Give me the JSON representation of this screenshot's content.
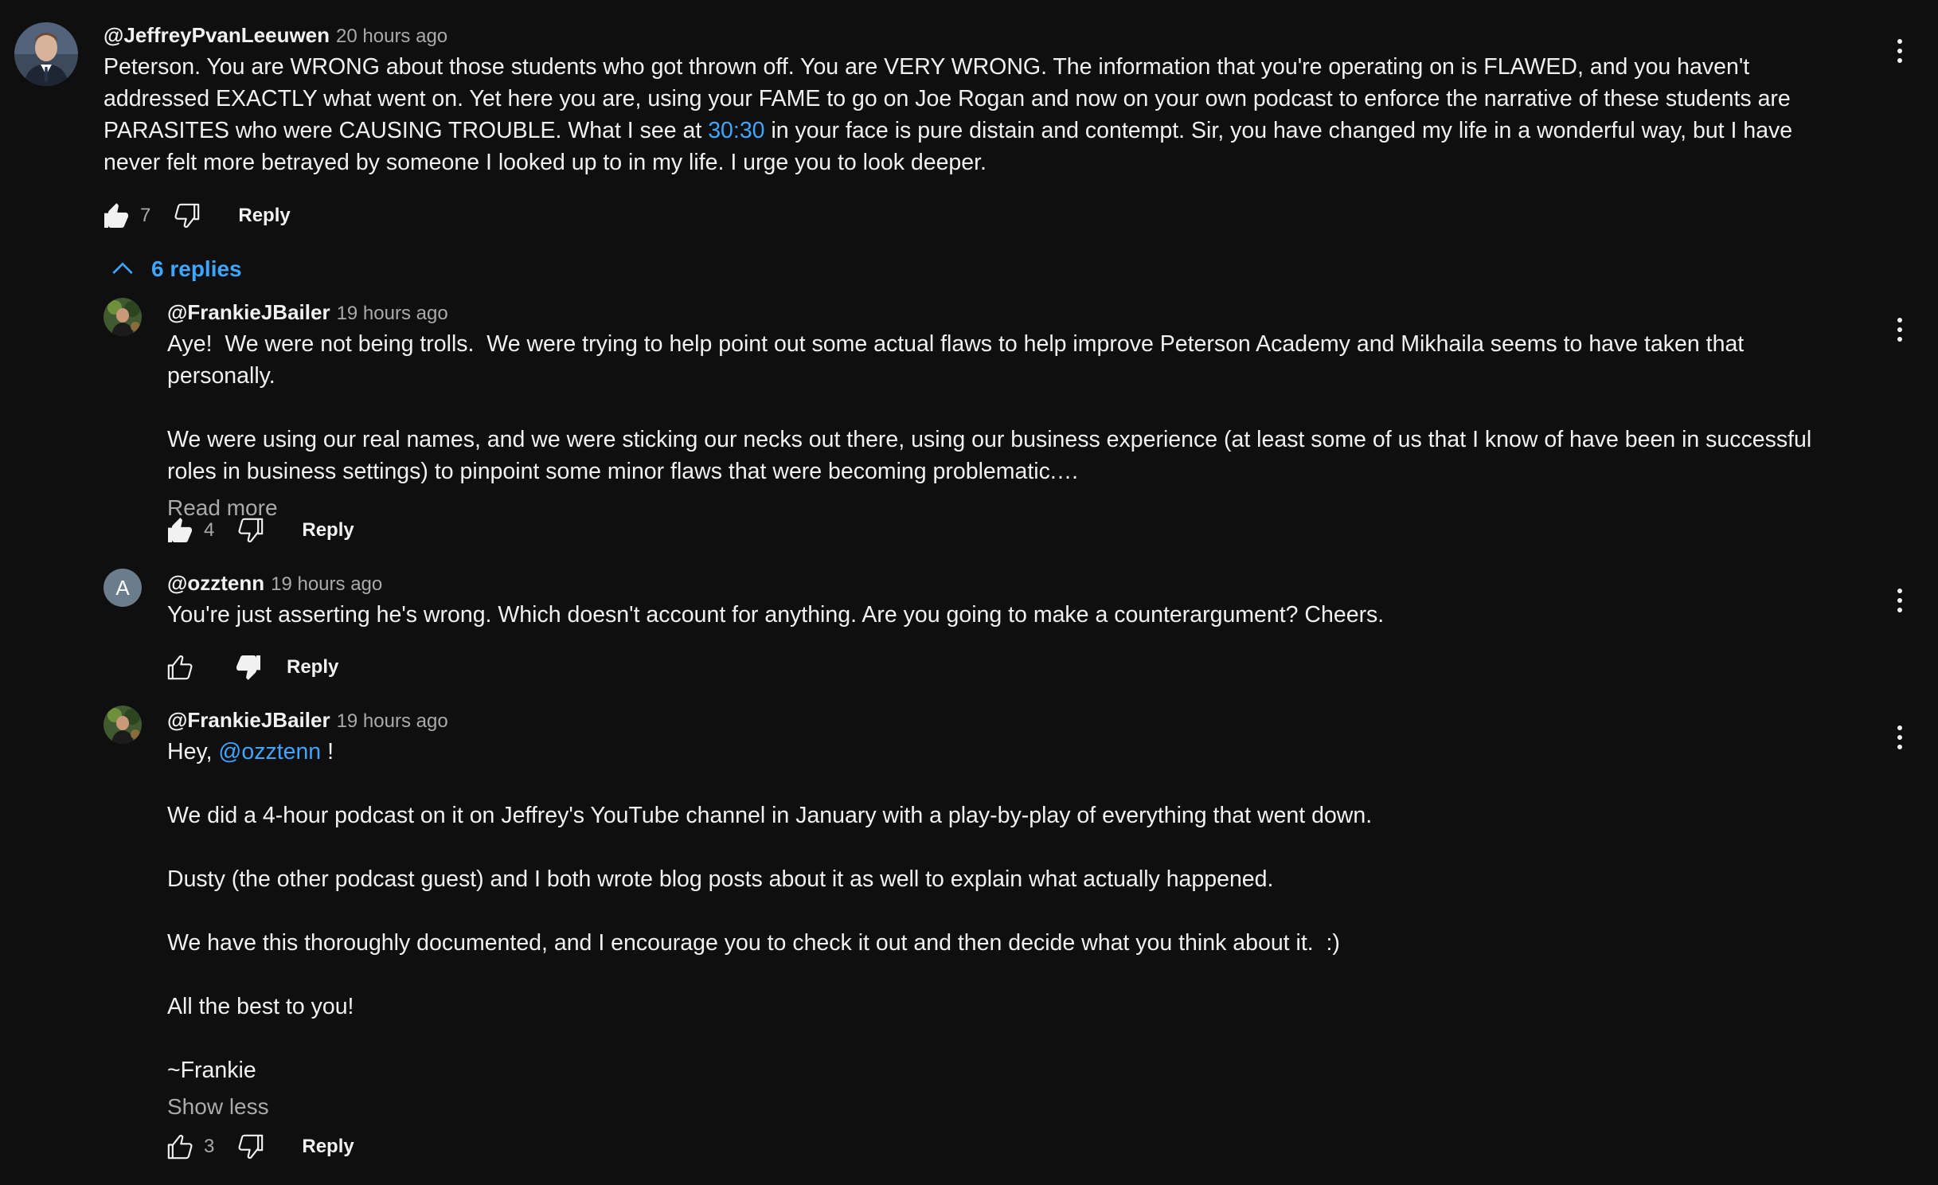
{
  "top_comment": {
    "author": "@JeffreyPvanLeeuwen",
    "time": "20 hours ago",
    "text_parts": [
      "Peterson. You are WRONG about those students who got thrown off. You are VERY WRONG. The information that you're operating on is FLAWED, and you haven't addressed EXACTLY what went on. Yet here you are, using your FAME to go on Joe Rogan and now on your own podcast to enforce the narrative of these students are PARASITES who were CAUSING TROUBLE. What I see at ",
      "30:30",
      " in your face is pure distain and contempt. Sir, you have changed my life in a wonderful way, but I have never felt more betrayed by someone I looked up to in my life. I urge you to look deeper."
    ],
    "likes": "7",
    "reply_label": "Reply"
  },
  "replies_toggle": {
    "label": "6 replies"
  },
  "replies": [
    {
      "author": "@FrankieJBailer",
      "time": "19 hours ago",
      "text": "Aye!  We were not being trolls.  We were trying to help point out some actual flaws to help improve Peterson Academy and Mikhaila seems to have taken that personally.\n\nWe were using our real names, and we were sticking our necks out there, using our business experience (at least some of us that I know of have been in successful roles in business settings) to pinpoint some minor flaws that were becoming problematic.…",
      "more_label": "Read more",
      "likes": "4",
      "reply_label": "Reply"
    },
    {
      "author": "@ozztenn",
      "avatar_letter": "A",
      "time": "19 hours ago",
      "text": "You're just asserting he's wrong. Which doesn't account for anything. Are you going to make a counterargument? Cheers.",
      "likes": "",
      "reply_label": "Reply"
    },
    {
      "author": "@FrankieJBailer",
      "time": "19 hours ago",
      "text_before_mention": "Hey, ",
      "mention": "@ozztenn",
      "text_after_mention": " !\n\nWe did a 4-hour podcast on it on Jeffrey's YouTube channel in January with a play-by-play of everything that went down.\n\nDusty (the other podcast guest) and I both wrote blog posts about it as well to explain what actually happened.\n\nWe have this thoroughly documented, and I encourage you to check it out and then decide what you think about it.  :)\n\nAll the best to you!\n\n~Frankie",
      "more_label": "Show less",
      "likes": "3",
      "reply_label": "Reply"
    }
  ],
  "colors": {
    "background": "#0f0f0f",
    "text": "#f1f1f1",
    "secondary_text": "#aaaaaa",
    "link": "#3ea6ff"
  }
}
